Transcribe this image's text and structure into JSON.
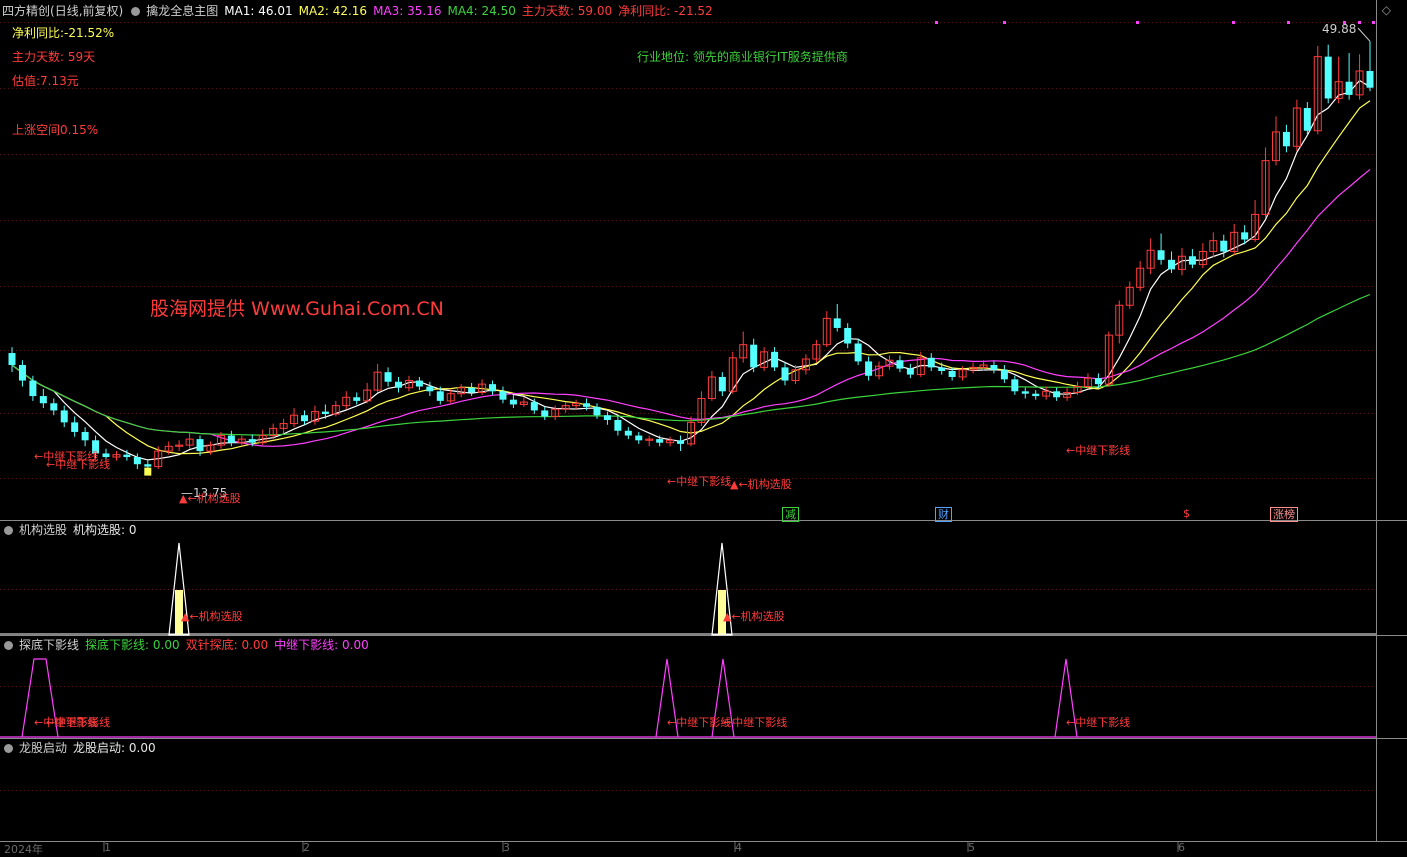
{
  "header": {
    "stock_name": "四方精创",
    "period": "(日线,前复权)",
    "indicator": "擒龙全息主图",
    "ma1": "MA1: 46.01",
    "ma2": "MA2: 42.16",
    "ma3": "MA3: 35.16",
    "ma4": "MA4: 24.50",
    "main_days": "主力天数: 59.00",
    "net_profit": "净利同比: -21.52"
  },
  "info": {
    "net_profit": "净利同比:-21.52%",
    "main_days": "主力天数: 59天",
    "valuation": "估值:7.13元",
    "upside": "上涨空间0.15%",
    "industry": "行业地位: 领先的商业银行IT服务提供商",
    "watermark": "股海网提供 Www.Guhai.Com.CN"
  },
  "price_labels": {
    "high": "49.88",
    "low": "13.75"
  },
  "annotations": {
    "zhongji_down": "←中继下影线",
    "jigou": "←机构选股",
    "jigou_marker": "▲"
  },
  "badges": [
    "减",
    "财",
    "$",
    "涨榜"
  ],
  "panels": {
    "jigou": {
      "title": "机构选股",
      "value": "机构选股: 0"
    },
    "tandi": {
      "title": "探底下影线",
      "v1": "探底下影线: 0.00",
      "v2": "双针探底: 0.00",
      "v3": "中继下影线: 0.00"
    },
    "longgu": {
      "title": "龙股启动",
      "value": "龙股启动: 0.00"
    }
  },
  "axis": {
    "year": "2024年",
    "months": [
      "1",
      "2",
      "3",
      "4",
      "5",
      "6"
    ]
  },
  "colors": {
    "up": "#ff3c3c",
    "down": "#54ffff",
    "ma1": "#ffffff",
    "ma2": "#ffff54",
    "ma3": "#ff40ff",
    "ma4": "#3cd23c"
  },
  "chart_data": {
    "type": "candlestick",
    "price_range": [
      10,
      52
    ],
    "highest": 49.88,
    "lowest": 13.75,
    "candles": [
      [
        23.8,
        22.8,
        24.3,
        22.2
      ],
      [
        22.8,
        21.5,
        23.2,
        21.0
      ],
      [
        21.5,
        20.2,
        21.9,
        19.8
      ],
      [
        20.2,
        19.6,
        20.8,
        19.2
      ],
      [
        19.6,
        19.0,
        20.0,
        18.6
      ],
      [
        19.0,
        18.0,
        19.4,
        17.6
      ],
      [
        18.0,
        17.2,
        18.5,
        16.8
      ],
      [
        17.2,
        16.5,
        17.6,
        16.0
      ],
      [
        16.5,
        15.4,
        16.9,
        15.0
      ],
      [
        15.4,
        15.1,
        15.8,
        14.7
      ],
      [
        15.1,
        15.3,
        15.6,
        14.8
      ],
      [
        15.3,
        15.1,
        15.7,
        14.8
      ],
      [
        15.1,
        14.5,
        15.4,
        14.1
      ],
      [
        14.5,
        14.3,
        14.8,
        13.75
      ],
      [
        14.3,
        15.6,
        16.0,
        14.1
      ],
      [
        15.6,
        16.0,
        16.4,
        15.3
      ],
      [
        16.0,
        16.1,
        16.5,
        15.6
      ],
      [
        16.1,
        16.6,
        17.1,
        15.8
      ],
      [
        16.6,
        15.6,
        16.9,
        15.2
      ],
      [
        15.6,
        16.1,
        16.4,
        15.3
      ],
      [
        16.1,
        16.9,
        17.2,
        15.8
      ],
      [
        16.9,
        16.3,
        17.3,
        16.0
      ],
      [
        16.3,
        16.6,
        16.9,
        16.0
      ],
      [
        16.6,
        16.3,
        17.0,
        16.0
      ],
      [
        16.3,
        16.9,
        17.4,
        16.1
      ],
      [
        16.9,
        17.5,
        17.9,
        16.6
      ],
      [
        17.5,
        17.9,
        18.3,
        17.1
      ],
      [
        17.9,
        18.6,
        19.2,
        17.6
      ],
      [
        18.6,
        18.1,
        19.0,
        17.8
      ],
      [
        18.1,
        18.9,
        19.4,
        17.8
      ],
      [
        18.9,
        18.7,
        19.5,
        18.3
      ],
      [
        18.7,
        19.4,
        19.8,
        18.5
      ],
      [
        19.4,
        20.1,
        20.6,
        19.1
      ],
      [
        20.1,
        19.8,
        20.5,
        19.5
      ],
      [
        19.8,
        20.7,
        21.3,
        19.6
      ],
      [
        20.7,
        22.2,
        22.9,
        20.5
      ],
      [
        22.2,
        21.4,
        22.6,
        21.0
      ],
      [
        21.4,
        20.9,
        21.8,
        20.5
      ],
      [
        20.9,
        21.5,
        21.9,
        20.6
      ],
      [
        21.5,
        21.0,
        21.8,
        20.7
      ],
      [
        21.0,
        20.6,
        21.4,
        20.2
      ],
      [
        20.6,
        19.8,
        21.0,
        19.5
      ],
      [
        19.8,
        20.4,
        20.8,
        19.6
      ],
      [
        20.4,
        20.9,
        21.2,
        20.1
      ],
      [
        20.9,
        20.5,
        21.3,
        20.2
      ],
      [
        20.5,
        21.2,
        21.6,
        20.3
      ],
      [
        21.2,
        20.6,
        21.5,
        20.3
      ],
      [
        20.6,
        19.9,
        21.0,
        19.6
      ],
      [
        19.9,
        19.5,
        20.3,
        19.2
      ],
      [
        19.5,
        19.7,
        20.1,
        19.3
      ],
      [
        19.7,
        19.0,
        20.0,
        18.7
      ],
      [
        19.0,
        18.5,
        19.3,
        18.2
      ],
      [
        18.5,
        19.1,
        19.4,
        18.2
      ],
      [
        19.1,
        19.4,
        19.7,
        18.8
      ],
      [
        19.4,
        19.6,
        19.9,
        19.1
      ],
      [
        19.6,
        19.3,
        20.0,
        19.0
      ],
      [
        19.3,
        18.6,
        19.6,
        18.3
      ],
      [
        18.6,
        18.2,
        18.9,
        17.8
      ],
      [
        18.2,
        17.3,
        18.5,
        16.9
      ],
      [
        17.3,
        16.9,
        17.6,
        16.6
      ],
      [
        16.9,
        16.5,
        17.2,
        16.2
      ],
      [
        16.5,
        16.6,
        16.9,
        16.0
      ],
      [
        16.6,
        16.3,
        16.9,
        16.0
      ],
      [
        16.3,
        16.5,
        16.8,
        16.0
      ],
      [
        16.5,
        16.2,
        16.9,
        15.6
      ],
      [
        16.2,
        18.0,
        18.5,
        16.0
      ],
      [
        18.0,
        20.0,
        20.6,
        17.7
      ],
      [
        20.0,
        21.8,
        22.3,
        19.8
      ],
      [
        21.8,
        20.6,
        22.2,
        20.2
      ],
      [
        20.6,
        23.4,
        23.9,
        20.4
      ],
      [
        23.4,
        24.5,
        25.6,
        23.0
      ],
      [
        24.5,
        22.6,
        25.0,
        22.2
      ],
      [
        22.6,
        23.9,
        24.3,
        22.3
      ],
      [
        23.9,
        22.6,
        24.3,
        22.3
      ],
      [
        22.6,
        21.5,
        23.0,
        21.1
      ],
      [
        21.5,
        22.4,
        22.8,
        21.2
      ],
      [
        22.4,
        23.3,
        23.7,
        22.0
      ],
      [
        23.3,
        24.5,
        24.9,
        23.0
      ],
      [
        24.5,
        26.7,
        27.3,
        24.3
      ],
      [
        26.7,
        25.9,
        27.9,
        25.6
      ],
      [
        25.9,
        24.6,
        26.3,
        24.2
      ],
      [
        24.6,
        23.1,
        25.0,
        22.8
      ],
      [
        23.1,
        21.9,
        23.5,
        21.5
      ],
      [
        21.9,
        22.7,
        23.1,
        21.6
      ],
      [
        22.7,
        23.2,
        23.6,
        22.4
      ],
      [
        23.2,
        22.5,
        23.6,
        22.2
      ],
      [
        22.5,
        22.0,
        22.9,
        21.7
      ],
      [
        22.0,
        23.4,
        23.9,
        21.8
      ],
      [
        23.4,
        22.6,
        23.8,
        22.3
      ],
      [
        22.6,
        22.3,
        23.0,
        22.0
      ],
      [
        22.3,
        21.8,
        22.6,
        21.5
      ],
      [
        21.8,
        22.4,
        22.7,
        21.5
      ],
      [
        22.4,
        22.6,
        23.0,
        22.1
      ],
      [
        22.6,
        22.8,
        23.2,
        22.3
      ],
      [
        22.8,
        22.4,
        23.1,
        22.1
      ],
      [
        22.4,
        21.6,
        22.8,
        21.3
      ],
      [
        21.6,
        20.6,
        21.9,
        20.3
      ],
      [
        20.6,
        20.4,
        20.9,
        20.0
      ],
      [
        20.4,
        20.2,
        20.7,
        19.9
      ],
      [
        20.2,
        20.6,
        21.0,
        19.9
      ],
      [
        20.6,
        20.1,
        20.9,
        19.8
      ],
      [
        20.1,
        20.5,
        20.9,
        19.8
      ],
      [
        20.5,
        21.0,
        21.4,
        20.3
      ],
      [
        21.0,
        21.7,
        22.1,
        20.8
      ],
      [
        21.7,
        21.2,
        22.1,
        20.9
      ],
      [
        21.2,
        25.3,
        25.6,
        21.0
      ],
      [
        25.3,
        27.8,
        28.2,
        24.6
      ],
      [
        27.8,
        29.3,
        29.8,
        27.5
      ],
      [
        29.3,
        30.9,
        31.5,
        29.0
      ],
      [
        30.9,
        32.4,
        33.4,
        30.4
      ],
      [
        32.4,
        31.6,
        33.8,
        31.2
      ],
      [
        31.6,
        30.8,
        32.3,
        30.5
      ],
      [
        30.8,
        31.9,
        32.6,
        30.3
      ],
      [
        31.9,
        31.2,
        32.5,
        30.9
      ],
      [
        31.2,
        32.3,
        33.0,
        30.9
      ],
      [
        32.3,
        33.2,
        33.9,
        31.8
      ],
      [
        33.2,
        32.3,
        33.7,
        31.8
      ],
      [
        32.3,
        33.9,
        34.6,
        32.0
      ],
      [
        33.9,
        33.3,
        34.5,
        32.9
      ],
      [
        33.3,
        35.4,
        36.6,
        33.1
      ],
      [
        35.4,
        39.9,
        41.0,
        35.1
      ],
      [
        39.9,
        42.3,
        43.6,
        39.5
      ],
      [
        42.3,
        41.1,
        42.9,
        40.6
      ],
      [
        41.1,
        44.3,
        45.0,
        40.7
      ],
      [
        44.3,
        42.4,
        44.8,
        42.0
      ],
      [
        42.4,
        48.6,
        49.5,
        42.1
      ],
      [
        48.6,
        45.1,
        49.6,
        44.7
      ],
      [
        45.1,
        46.5,
        48.6,
        44.7
      ],
      [
        46.5,
        45.4,
        48.9,
        45.0
      ],
      [
        45.4,
        47.4,
        48.8,
        45.0
      ],
      [
        47.4,
        46.0,
        49.88,
        45.7
      ]
    ]
  }
}
